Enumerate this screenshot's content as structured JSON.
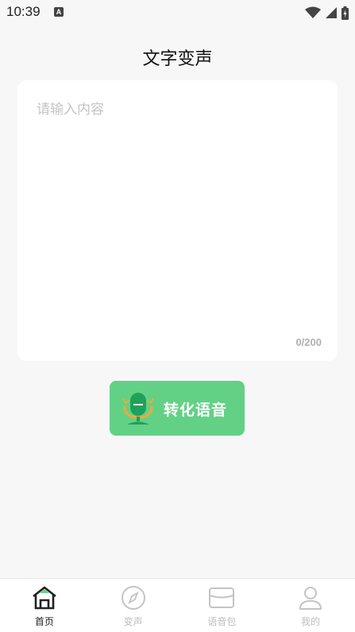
{
  "status_bar": {
    "time": "10:39",
    "notification_letter": "A"
  },
  "page": {
    "title": "文字变声"
  },
  "editor": {
    "placeholder": "请输入内容",
    "value": "",
    "char_count": "0/200"
  },
  "convert": {
    "label": "转化语音"
  },
  "nav": {
    "items": [
      {
        "label": "首页",
        "icon": "home-icon",
        "active": true
      },
      {
        "label": "变声",
        "icon": "compass-icon",
        "active": false
      },
      {
        "label": "语音包",
        "icon": "wallet-icon",
        "active": false
      },
      {
        "label": "我的",
        "icon": "user-icon",
        "active": false
      }
    ]
  },
  "colors": {
    "accent": "#62d186",
    "background": "#f7f7f7",
    "inactive": "#bdbdbd"
  }
}
